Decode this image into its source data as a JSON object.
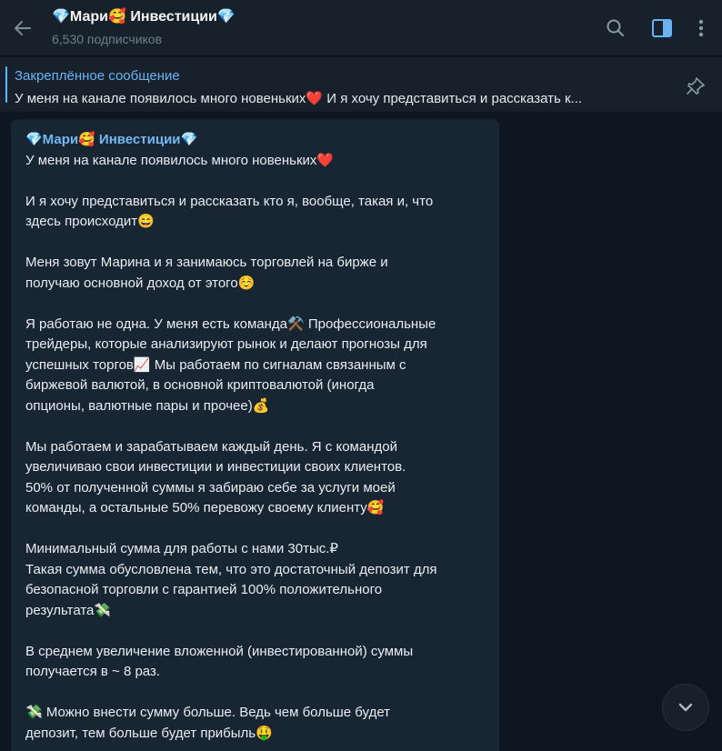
{
  "header": {
    "title": "💎Мари🥰 Инвестиции💎",
    "subscribers": "6,530 подписчиков"
  },
  "pinned": {
    "title": "Закреплённое сообщение",
    "text": "У меня на канале появилось много новеньких❤️  И я хочу представиться и рассказать к..."
  },
  "message": {
    "author": "💎Мари🥰 Инвестиции💎",
    "lines": [
      "У меня на канале появилось много новеньких❤️",
      "",
      "И я хочу представиться и рассказать кто я, вообще, такая и, что",
      "здесь происходит😄",
      "",
      "Меня зовут Марина и я занимаюсь торговлей на бирже и",
      "получаю основной доход от этого☺️",
      "",
      "Я работаю не одна. У меня есть команда⚒️  Профессиональные",
      "трейдеры, которые анализируют рынок и делают прогнозы для",
      "успешных торгов📈 Мы работаем по сигналам связанным с",
      "биржевой валютой, в основной криптовалютой (иногда",
      "опционы, валютные пары и прочее)💰",
      "",
      "Мы работаем и зарабатываем каждый день. Я с командой",
      "увеличиваю свои инвестиции и инвестиции своих клиентов.",
      "50% от полученной суммы я забираю себе за услуги моей",
      "команды, а остальные 50% перевожу своему клиенту🥰",
      "",
      "Минимальный сумма для работы с нами 30тыс.₽",
      "Такая сумма обусловлена тем, что это достаточный депозит для",
      "безопасной торговли с гарантией 100% положительного",
      "результата💸",
      "",
      "В среднем увеличение вложенной (инвестированной) суммы",
      "получается в ~ 8 раз.",
      "",
      "💸 Можно внести сумму больше. Ведь чем больше будет",
      "депозит, тем больше будет прибыль🤑"
    ]
  },
  "colors": {
    "background": "#0e1621",
    "header": "#17212b",
    "bubble": "#182533",
    "accent": "#6ab3f3"
  },
  "icons": {
    "back": "arrow-left-icon",
    "search": "search-icon",
    "sidebar": "sidebar-toggle-icon",
    "more": "more-vertical-icon",
    "pin": "unpin-icon",
    "scroll": "chevron-down-icon"
  }
}
